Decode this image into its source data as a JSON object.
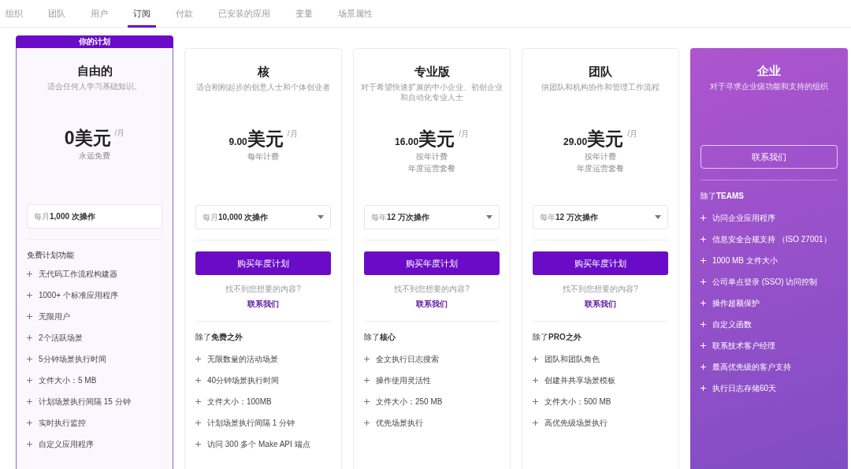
{
  "tabs": [
    {
      "label": "组织",
      "selected": false
    },
    {
      "label": "团队",
      "selected": false
    },
    {
      "label": "用户",
      "selected": false
    },
    {
      "label": "订阅",
      "selected": true
    },
    {
      "label": "付款",
      "selected": false
    },
    {
      "label": "已安装的应用",
      "selected": false
    },
    {
      "label": "变量",
      "selected": false
    },
    {
      "label": "场景属性",
      "selected": false
    }
  ],
  "plans": [
    {
      "kind": "free",
      "current": true,
      "badge": "你的计划",
      "title": "自由的",
      "subtitle": "适合任何人学习基础知识。",
      "amount": "0",
      "currency": "美元",
      "period": "/月",
      "notes": [
        "永远免费"
      ],
      "operations": {
        "value": "每月**1,000 次操作**",
        "has_dropdown": false
      },
      "features_heading": "免费计划功能",
      "features": [
        "无代码工作流程构建器",
        "1000+ 个标准应用程序",
        "无限用户",
        "2个活跃场景",
        "5分钟场景执行时间",
        "文件大小：5 MB",
        "计划场景执行间隔 15 分钟",
        "实时执行监控",
        "自定义应用程序"
      ]
    },
    {
      "kind": "paid",
      "current": false,
      "title": "核",
      "subtitle": "适合刚刚起步的创意人士和个体创业者",
      "amount": "9.00",
      "currency": "美元",
      "period": "/月",
      "notes": [
        "每年计费"
      ],
      "operations": {
        "value": "每月**10,000 次操作**",
        "has_dropdown": true
      },
      "button": "购买年度计划",
      "help": "找不到您想要的内容?",
      "contact_link": "联系我们",
      "features_heading": "除了**免费之外**",
      "features": [
        "无限数量的活动场景",
        "40分钟场景执行时间",
        "文件大小：100MB",
        "计划场景执行间隔 1 分钟",
        "访问 300 多个 Make API 端点"
      ]
    },
    {
      "kind": "paid",
      "current": false,
      "title": "专业版",
      "subtitle": "对于希望快速扩展的中小企业、初创企业和自动化专业人士",
      "amount": "16.00",
      "currency": "美元",
      "period": "/月",
      "notes": [
        "按年计费",
        "年度运营套餐"
      ],
      "operations": {
        "value": "每年**12 万次操作**",
        "has_dropdown": true
      },
      "button": "购买年度计划",
      "help": "找不到您想要的内容?",
      "contact_link": "联系我们",
      "features_heading": "除了**核心**",
      "features": [
        "全文执行日志搜索",
        "操作使用灵活性",
        "文件大小：250 MB",
        "优先场景执行"
      ]
    },
    {
      "kind": "paid",
      "current": false,
      "title": "团队",
      "subtitle": "供团队和机构协作和管理工作流程",
      "amount": "29.00",
      "currency": "美元",
      "period": "/月",
      "notes": [
        "按年计费",
        "年度运营套餐"
      ],
      "operations": {
        "value": "每年**12 万次操作**",
        "has_dropdown": true
      },
      "button": "购买年度计划",
      "help": "找不到您想要的内容?",
      "contact_link": "联系我们",
      "features_heading": "除了**PRO之外**",
      "features": [
        "团队和团队角色",
        "创建并共享场景模板",
        "文件大小：500 MB",
        "高优先级场景执行"
      ]
    },
    {
      "kind": "enterprise",
      "current": false,
      "title": "企业",
      "subtitle": "对于寻求企业级功能和支持的组织",
      "button": "联系我们",
      "features_heading": "除了**TEAMS**",
      "features": [
        "访问企业应用程序",
        "信息安全合规支持 （ISO 27001）",
        "1000 MB 文件大小",
        "公司单点登录 (SSO) 访问控制",
        "操作超额保护",
        "自定义函数",
        "联系技术客户经理",
        "最高优先级的客户支持",
        "执行日志存储60天"
      ]
    }
  ]
}
